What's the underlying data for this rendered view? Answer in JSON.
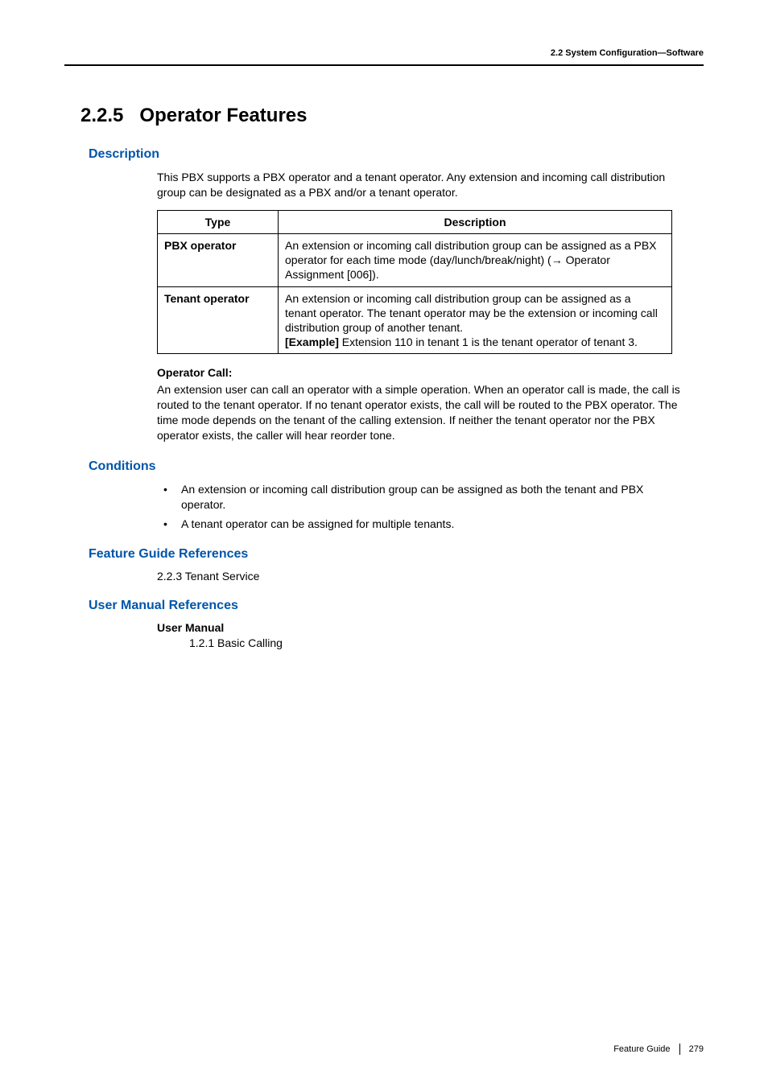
{
  "header": {
    "breadcrumb": "2.2 System Configuration—Software"
  },
  "section": {
    "number": "2.2.5",
    "title": "Operator Features"
  },
  "description": {
    "heading": "Description",
    "intro": "This PBX supports a PBX operator and a tenant operator. Any extension and incoming call distribution group can be designated as a PBX and/or a tenant operator.",
    "table": {
      "head_type": "Type",
      "head_desc": "Description",
      "rows": [
        {
          "type": "PBX operator",
          "desc_part1": "An extension or incoming call distribution group can be assigned as a PBX operator for each time mode (day/lunch/break/night) (",
          "desc_part2": " Operator Assignment [006])."
        },
        {
          "type": "Tenant operator",
          "desc_line1": "An extension or incoming call distribution group can be assigned as a tenant operator. The tenant operator may be the extension or incoming call distribution group of another tenant.",
          "example_label": "[Example]",
          "example_text": " Extension 110 in tenant 1 is the tenant operator of tenant 3."
        }
      ]
    },
    "opcall_label": "Operator Call:",
    "opcall_text": "An extension user can call an operator with a simple operation. When an operator call is made, the call is routed to the tenant operator. If no tenant operator exists, the call will be routed to the PBX operator. The time mode depends on the tenant of the calling extension. If neither the tenant operator nor the PBX operator exists, the caller will hear reorder tone."
  },
  "conditions": {
    "heading": "Conditions",
    "items": [
      "An extension or incoming call distribution group can be assigned as both the tenant and PBX operator.",
      "A tenant operator can be assigned for multiple tenants."
    ]
  },
  "feature_guide": {
    "heading": "Feature Guide References",
    "item": "2.2.3 Tenant Service"
  },
  "user_manual": {
    "heading": "User Manual References",
    "sub_label": "User Manual",
    "item": "1.2.1 Basic Calling"
  },
  "footer": {
    "guide": "Feature Guide",
    "page": "279"
  }
}
